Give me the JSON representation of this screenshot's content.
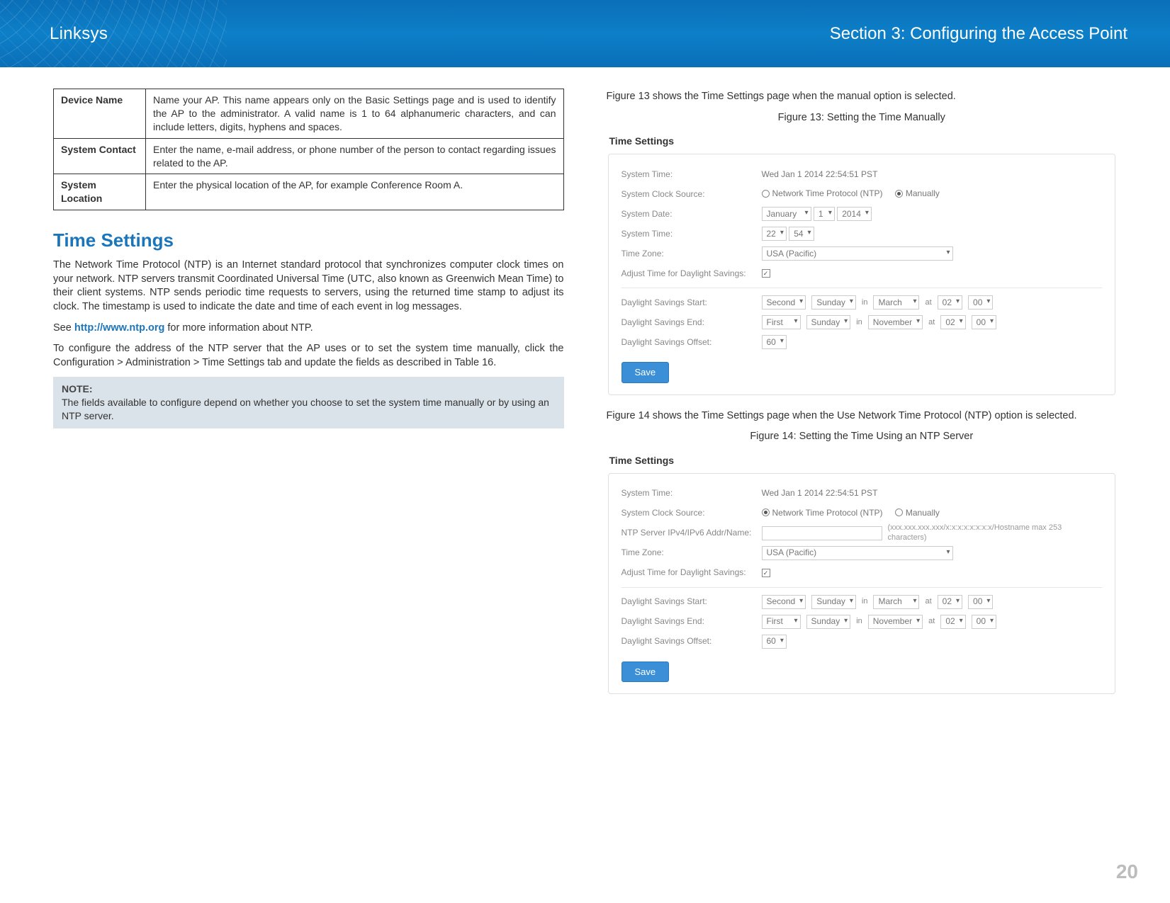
{
  "header": {
    "brand": "Linksys",
    "section": "Section 3:  Configuring the Access Point"
  },
  "table": {
    "rows": [
      {
        "term": "Device Name",
        "desc": "Name your AP. This name appears only on the Basic Settings page and is used to identify the AP to the administrator. A valid name is 1 to 64 alphanumeric characters, and can include letters, digits, hyphens and spaces."
      },
      {
        "term": "System Contact",
        "desc": "Enter the name, e-mail address, or phone number of the person to contact regarding issues related to the AP."
      },
      {
        "term": "System Location",
        "desc": "Enter the physical location of the AP, for example Conference Room A."
      }
    ]
  },
  "ts": {
    "heading": "Time Settings",
    "p1": "The Network Time Protocol (NTP) is an Internet standard protocol that synchronizes computer clock times on your network. NTP servers transmit Coordinated Universal Time (UTC, also known as Greenwich Mean Time) to their client systems. NTP sends periodic time requests to servers, using the returned time stamp to adjust its clock. The timestamp is used to indicate the date and time of each event in log messages.",
    "p2a": "See ",
    "p2link": "http://www.ntp.org",
    "p2b": " for more information about NTP.",
    "p3": "To configure the address of the NTP server that the AP uses or to set the system time manually, click the Configuration > Administration > Time Settings tab and update the fields as described in Table 16.",
    "note_label": "NOTE:",
    "note_body": "The fields available to configure depend on whether you choose to set the system time manually or by using an NTP server."
  },
  "right": {
    "intro13": "Figure 13 shows the Time Settings page when the manual option is selected.",
    "cap13": "Figure 13: Setting the Time Manually",
    "intro14": "Figure 14 shows the Time Settings page when the Use Network Time Protocol (NTP) option is selected.",
    "cap14": "Figure 14: Setting the Time Using an NTP Server"
  },
  "ss": {
    "title": "Time Settings",
    "labels": {
      "sys_time": "System Time:",
      "clock_src": "System Clock Source:",
      "sys_date": "System Date:",
      "sys_time2": "System Time:",
      "tz": "Time Zone:",
      "adj": "Adjust Time for Daylight Savings:",
      "start": "Daylight Savings Start:",
      "end": "Daylight Savings End:",
      "offset": "Daylight Savings Offset:",
      "ntp_addr": "NTP Server IPv4/IPv6 Addr/Name:"
    },
    "vals": {
      "sys_time": "Wed Jan 1 2014 22:54:51 PST",
      "ntp_radio": "Network Time Protocol (NTP)",
      "man_radio": "Manually",
      "month": "January",
      "day": "1",
      "year": "2014",
      "hour": "22",
      "min": "54",
      "tz": "USA (Pacific)",
      "chk": "✓",
      "week_second": "Second",
      "week_first": "First",
      "dow": "Sunday",
      "in": "in",
      "at": "at",
      "mon_march": "March",
      "mon_nov": "November",
      "h02": "02",
      "m00": "00",
      "offset": "60",
      "ntp_hint": "(xxx.xxx.xxx.xxx/x:x:x:x:x:x:x:x/Hostname max 253 characters)"
    },
    "save": "Save"
  },
  "page_number": "20"
}
